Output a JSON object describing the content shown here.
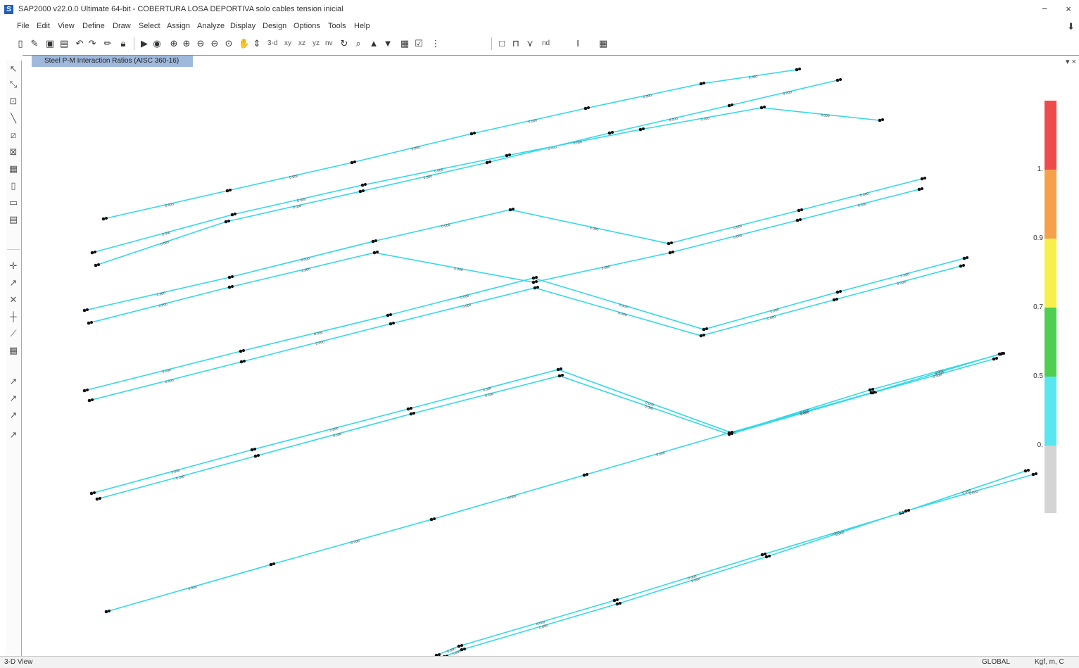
{
  "window": {
    "title": "SAP2000 v22.0.0 Ultimate 64-bit - COBERTURA LOSA DEPORTIVA solo cables tension inicial",
    "icon": "sap2000-app-icon",
    "minimize_label": "−",
    "close_label": "×"
  },
  "menu": {
    "items": [
      "File",
      "Edit",
      "View",
      "Define",
      "Draw",
      "Select",
      "Assign",
      "Analyze",
      "Display",
      "Design",
      "Options",
      "Tools",
      "Help"
    ],
    "pin_icon": "pin-icon"
  },
  "toolbar": {
    "view_xy": "3-d",
    "btn_xy": "xy",
    "btn_xz": "xz",
    "btn_yz": "yz",
    "btn_nv": "nv",
    "nd_label": "nd"
  },
  "view": {
    "tab_title": "Steel P-M Interaction Ratios (AISC 360-16)",
    "close_label": "▾ ×",
    "colors": {
      "member": "#35d8e8",
      "joint": "#111111",
      "tab": "#9fb9dc"
    }
  },
  "legend": {
    "bands": [
      {
        "color": "#ef4b4b"
      },
      {
        "color": "#f7a04a"
      },
      {
        "color": "#f7f04a"
      },
      {
        "color": "#4fce4f"
      },
      {
        "color": "#58e6f0"
      },
      {
        "color": "#d4d4d4"
      }
    ],
    "labels": [
      "1.",
      "0.9",
      "0.7",
      "0.5",
      "0."
    ]
  },
  "status": {
    "view_name": "3-D View",
    "coord_system": "GLOBAL",
    "units": "Kgf, m, C"
  },
  "model": {
    "ratio_label": "0.000"
  }
}
